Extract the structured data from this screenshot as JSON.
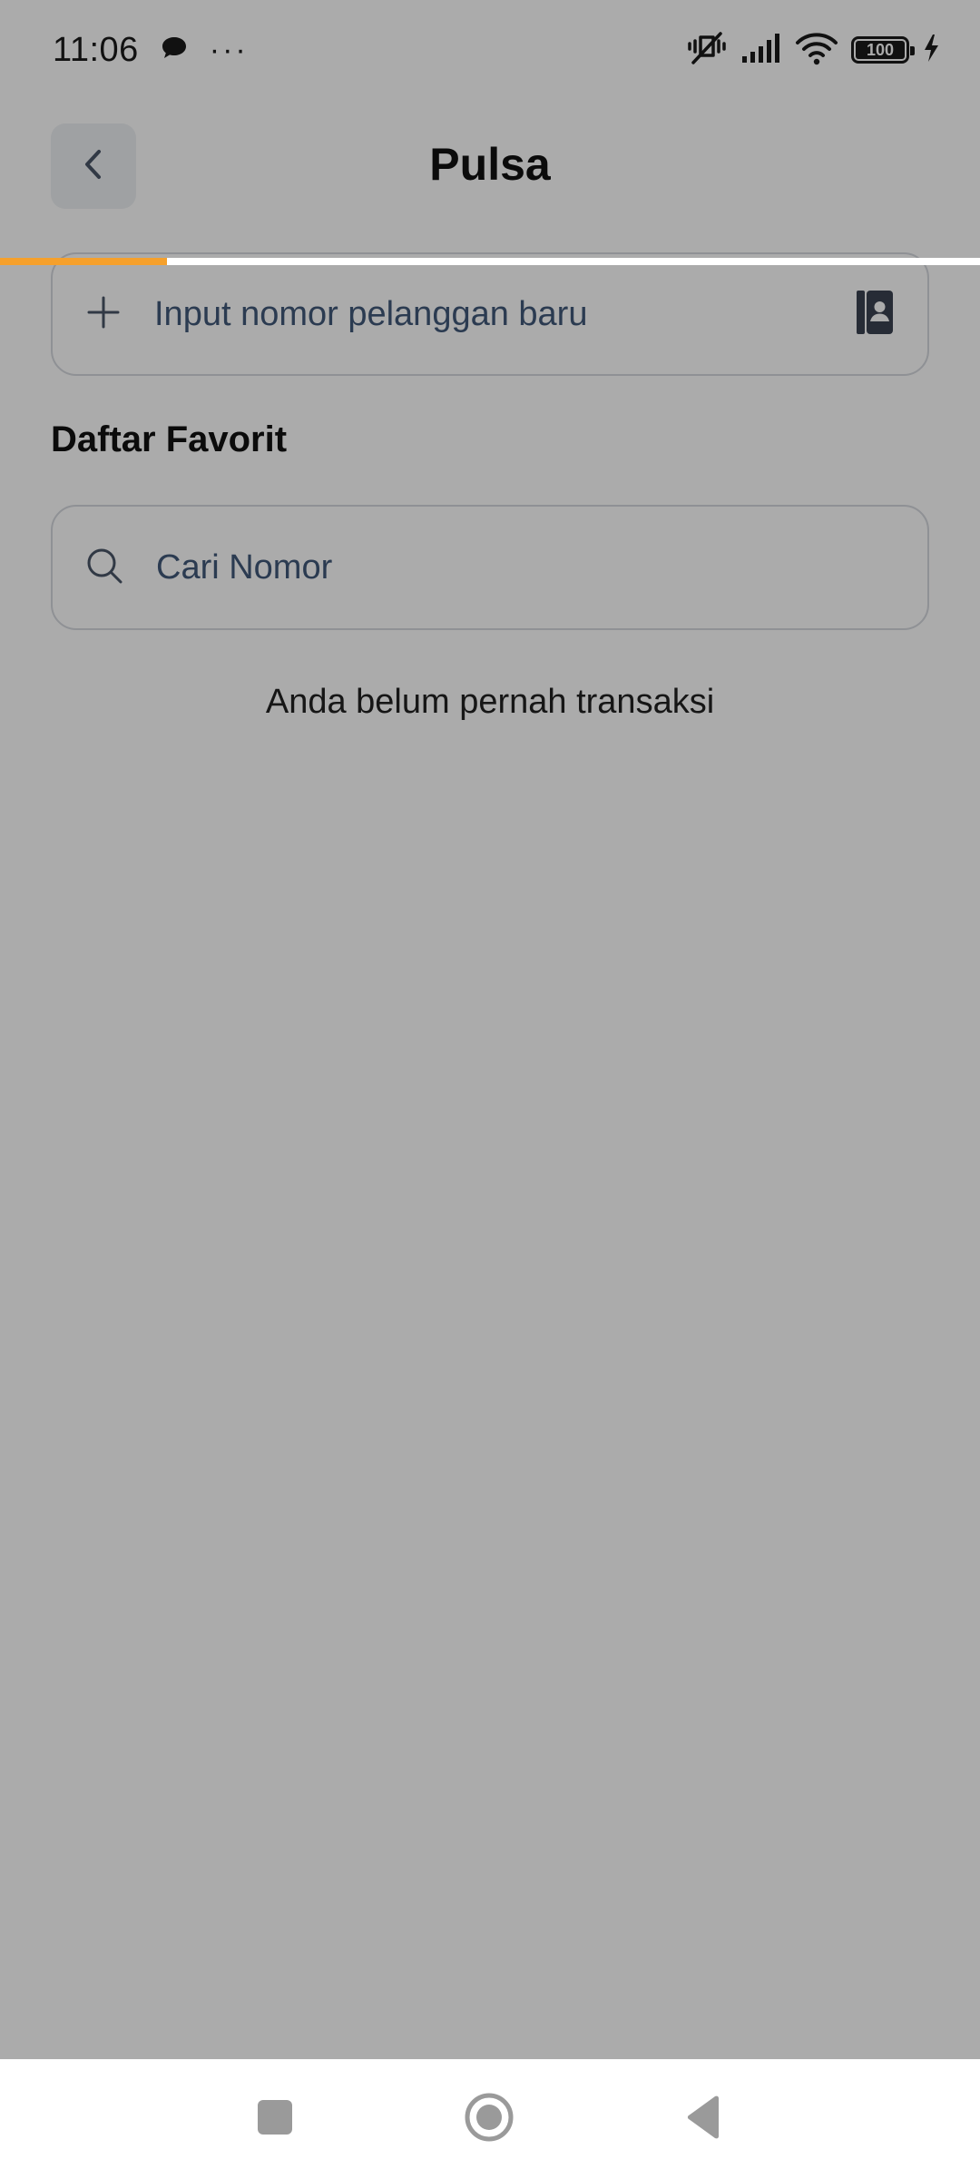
{
  "status_bar": {
    "time": "11:06",
    "more_indicator": "···",
    "battery_level": "100",
    "icons": [
      "chat-bubble-icon",
      "vibrate-mute-icon",
      "signal-icon",
      "wifi-icon",
      "battery-icon",
      "charging-icon"
    ]
  },
  "header": {
    "title": "Pulsa"
  },
  "loading_progress": 0.17,
  "new_number": {
    "label": "Input nomor pelanggan baru"
  },
  "favorites": {
    "title": "Daftar Favorit",
    "search_placeholder": "Cari Nomor",
    "empty_text": "Anda belum pernah transaksi"
  },
  "colors": {
    "accent_progress": "#f5a02c",
    "field_text": "#415879"
  }
}
